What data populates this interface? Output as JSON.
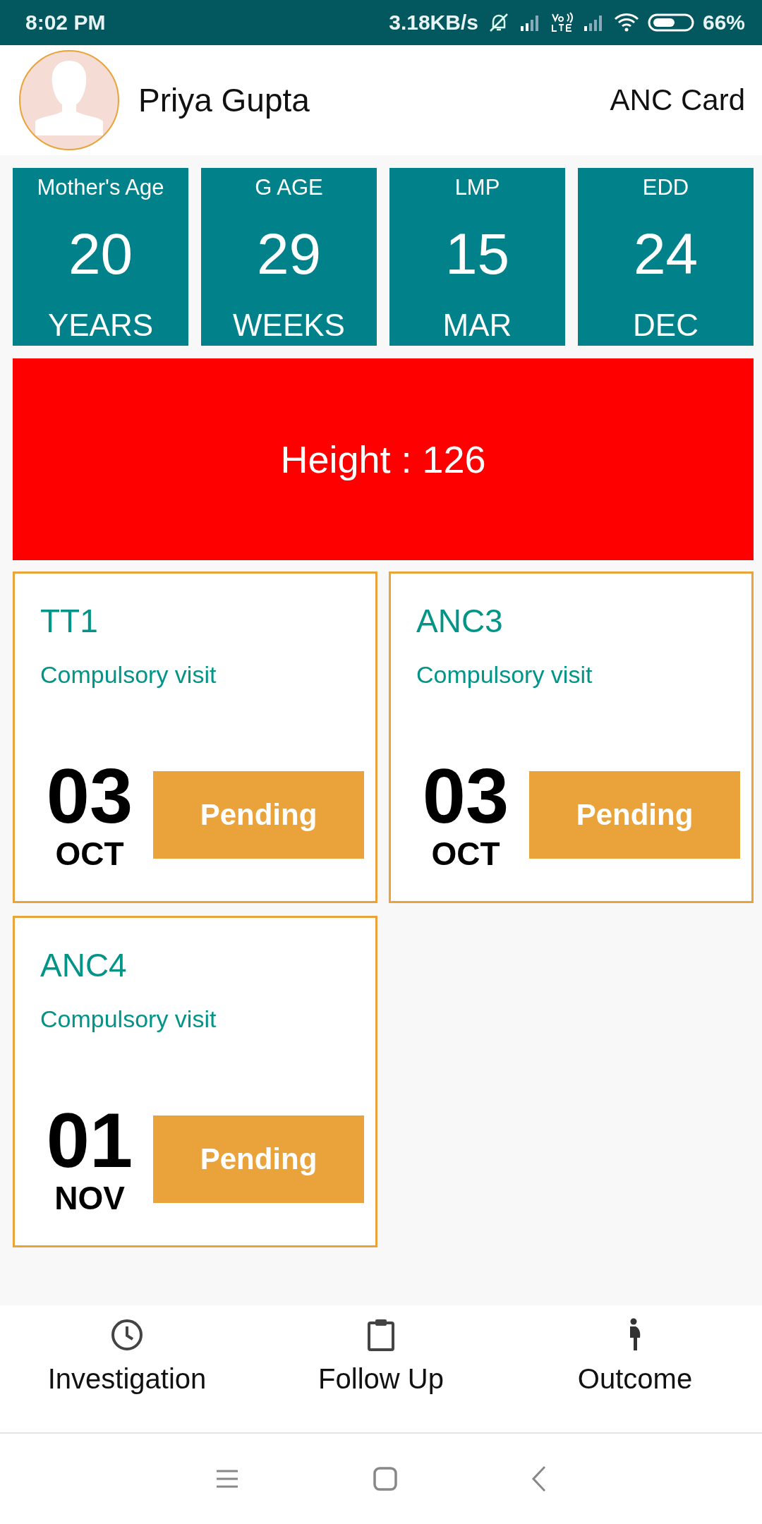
{
  "status_bar": {
    "time": "8:02 PM",
    "speed": "3.18KB/s",
    "battery": "66%"
  },
  "header": {
    "name": "Priya Gupta",
    "title": "ANC Card"
  },
  "stats": [
    {
      "label": "Mother's Age",
      "value": "20",
      "unit": "YEARS"
    },
    {
      "label": "G AGE",
      "value": "29",
      "unit": "WEEKS"
    },
    {
      "label": "LMP",
      "value": "15",
      "unit": "MAR"
    },
    {
      "label": "EDD",
      "value": "24",
      "unit": "DEC"
    }
  ],
  "banner": {
    "text": "Height : 126"
  },
  "visits": [
    {
      "name": "TT1",
      "type": "Compulsory visit",
      "day": "03",
      "month": "OCT",
      "status": "Pending"
    },
    {
      "name": "ANC3",
      "type": "Compulsory visit",
      "day": "03",
      "month": "OCT",
      "status": "Pending"
    },
    {
      "name": "ANC4",
      "type": "Compulsory visit",
      "day": "01",
      "month": "NOV",
      "status": "Pending"
    }
  ],
  "bottom_nav": [
    {
      "label": "Investigation",
      "kind": "clock"
    },
    {
      "label": "Follow Up",
      "kind": "clipboard"
    },
    {
      "label": "Outcome",
      "kind": "figure"
    }
  ]
}
